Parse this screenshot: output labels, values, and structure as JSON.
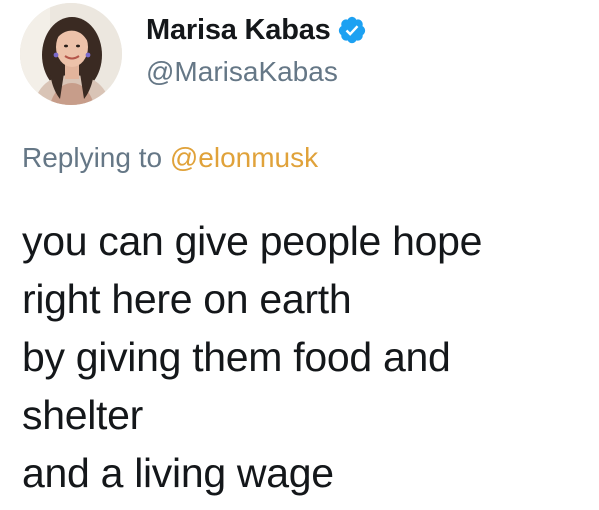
{
  "author": {
    "display_name": "Marisa Kabas",
    "handle": "@MarisaKabas",
    "verified": true,
    "avatar_icon": "profile-photo"
  },
  "reply": {
    "prefix": "Replying to ",
    "mention": "@elonmusk"
  },
  "tweet": {
    "lines": [
      "you can give people hope",
      "right here on earth",
      "by giving them food and",
      "shelter",
      "and a living wage"
    ]
  },
  "colors": {
    "verified_badge": "#1da1f2",
    "handle_text": "#657786",
    "mention_text": "#e0a23a",
    "body_text": "#14171a"
  }
}
